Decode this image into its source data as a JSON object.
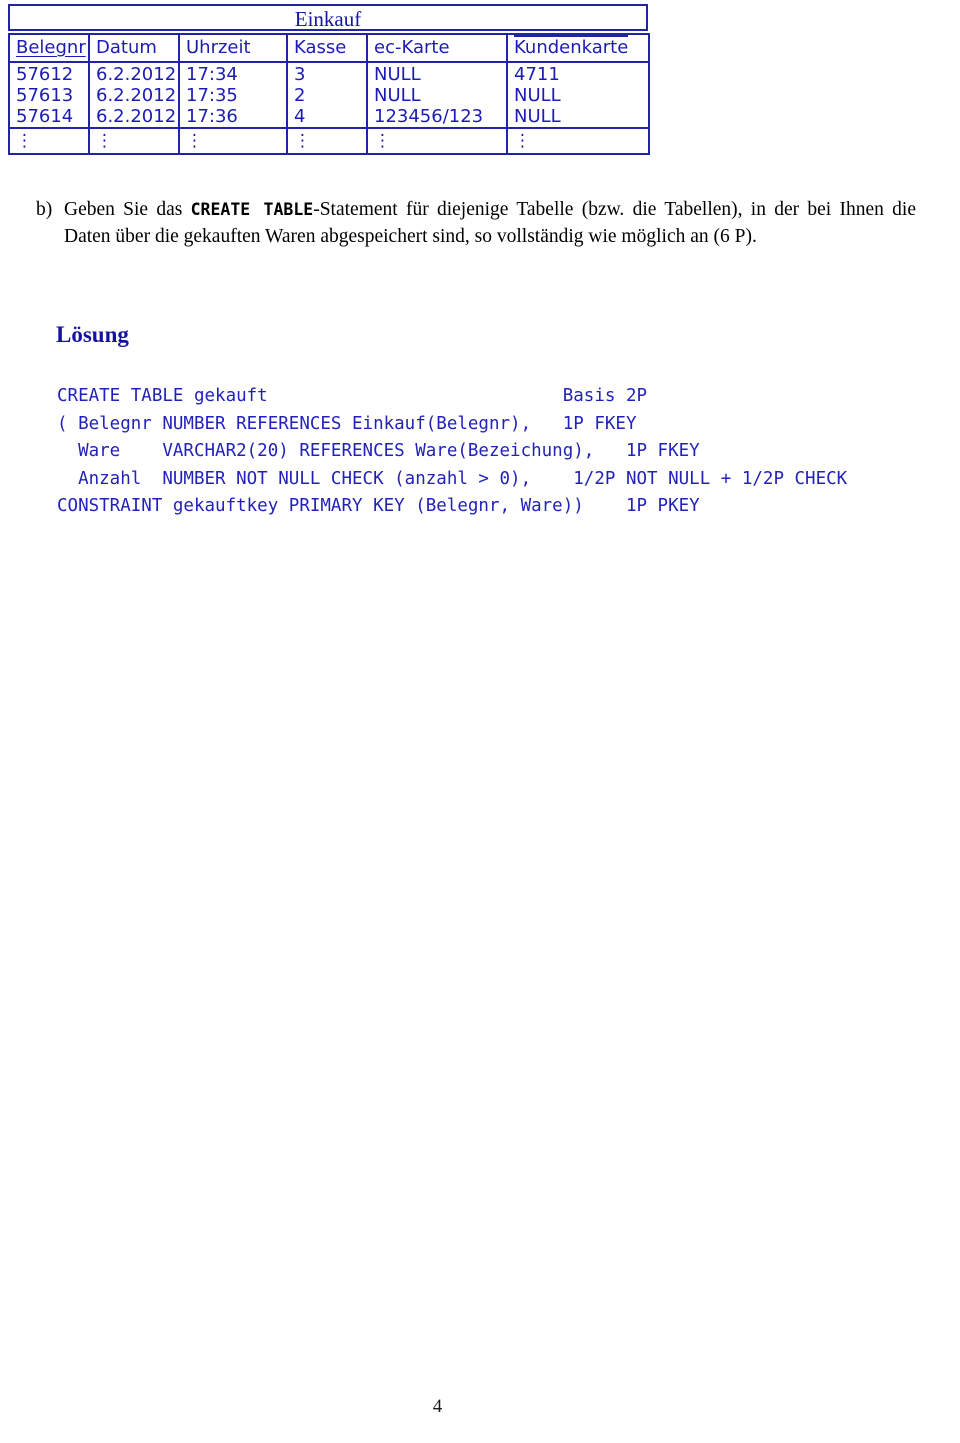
{
  "relation": {
    "title": "Einkauf",
    "columns": [
      {
        "label": "Belegnr",
        "key": "pk"
      },
      {
        "label": "Datum",
        "key": "none"
      },
      {
        "label": "Uhrzeit",
        "key": "none"
      },
      {
        "label": "Kasse",
        "key": "none"
      },
      {
        "label": "ec-Karte",
        "key": "none"
      },
      {
        "label": "Kundenkarte",
        "key": "fk"
      }
    ],
    "rows": [
      [
        "57612",
        "6.2.2012",
        "17:34",
        "3",
        "NULL",
        "4711"
      ],
      [
        "57613",
        "6.2.2012",
        "17:35",
        "2",
        "NULL",
        "NULL"
      ],
      [
        "57614",
        "6.2.2012",
        "17:36",
        "4",
        "123456/123",
        "NULL"
      ]
    ],
    "continuation_symbol": "⋮",
    "border_color": "#2222aa",
    "text_color": "#1c1cb4"
  },
  "question": {
    "marker": "b)",
    "part1": "Geben Sie das ",
    "mono": "CREATE TABLE",
    "part2": "-Statement für diejenige Tabelle (bzw. die Tabellen), in der bei Ihnen die Daten über die gekauften Waren abgespeichert sind, so vollständig wie möglich an (6 P)."
  },
  "solution": {
    "heading": "Lösung",
    "heading_color": "#1414a0",
    "code_color": "#2222bb",
    "code_lines": [
      "CREATE TABLE gekauft                            Basis 2P",
      "( Belegnr NUMBER REFERENCES Einkauf(Belegnr),   1P FKEY",
      "  Ware    VARCHAR2(20) REFERENCES Ware(Bezeichung),   1P FKEY",
      "  Anzahl  NUMBER NOT NULL CHECK (anzahl > 0),    1/2P NOT NULL + 1/2P CHECK",
      "CONSTRAINT gekauftkey PRIMARY KEY (Belegnr, Ware))    1P PKEY"
    ]
  },
  "footer": {
    "page_number": "4"
  }
}
